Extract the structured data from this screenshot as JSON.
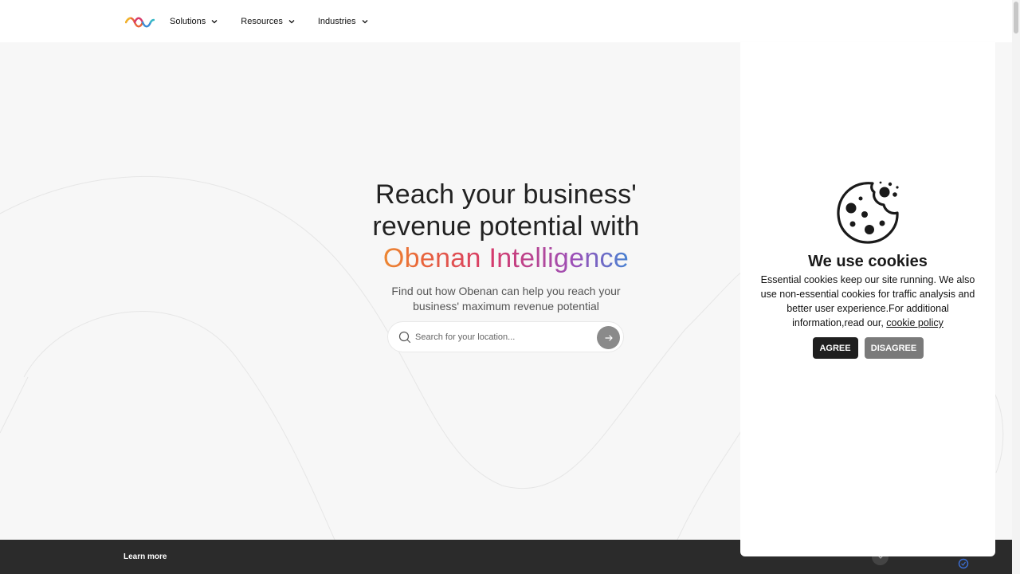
{
  "nav": {
    "logo": "obenan-wave-logo",
    "items": [
      {
        "label": "Solutions"
      },
      {
        "label": "Resources"
      },
      {
        "label": "Industries"
      }
    ]
  },
  "hero": {
    "title_line1": "Reach your business'",
    "title_line2": "revenue potential with",
    "brand": "Obenan Intelligence",
    "subtitle_line1": "Find out how Obenan can help you reach your",
    "subtitle_line2": "business' maximum revenue potential"
  },
  "search": {
    "placeholder": "Search for your location..."
  },
  "cookie": {
    "title": "We use cookies",
    "text": "Essential cookies keep our site running. We also use non-essential cookies for traffic analysis and better user experience.For additional information,read our,",
    "link": "cookie policy",
    "agree_label": "AGREE",
    "disagree_label": "DISAGREE"
  },
  "footer": {
    "learn_more": "Learn more"
  },
  "colors": {
    "brand_gradient": [
      "#f0b52a",
      "#e9663a",
      "#d73a6a",
      "#9b4fb8",
      "#3c8bd6",
      "#35b7c6"
    ],
    "footer_bg": "#2b2b2b",
    "agree_bg": "#1f1f1f",
    "disagree_bg": "#7a7a7a"
  }
}
